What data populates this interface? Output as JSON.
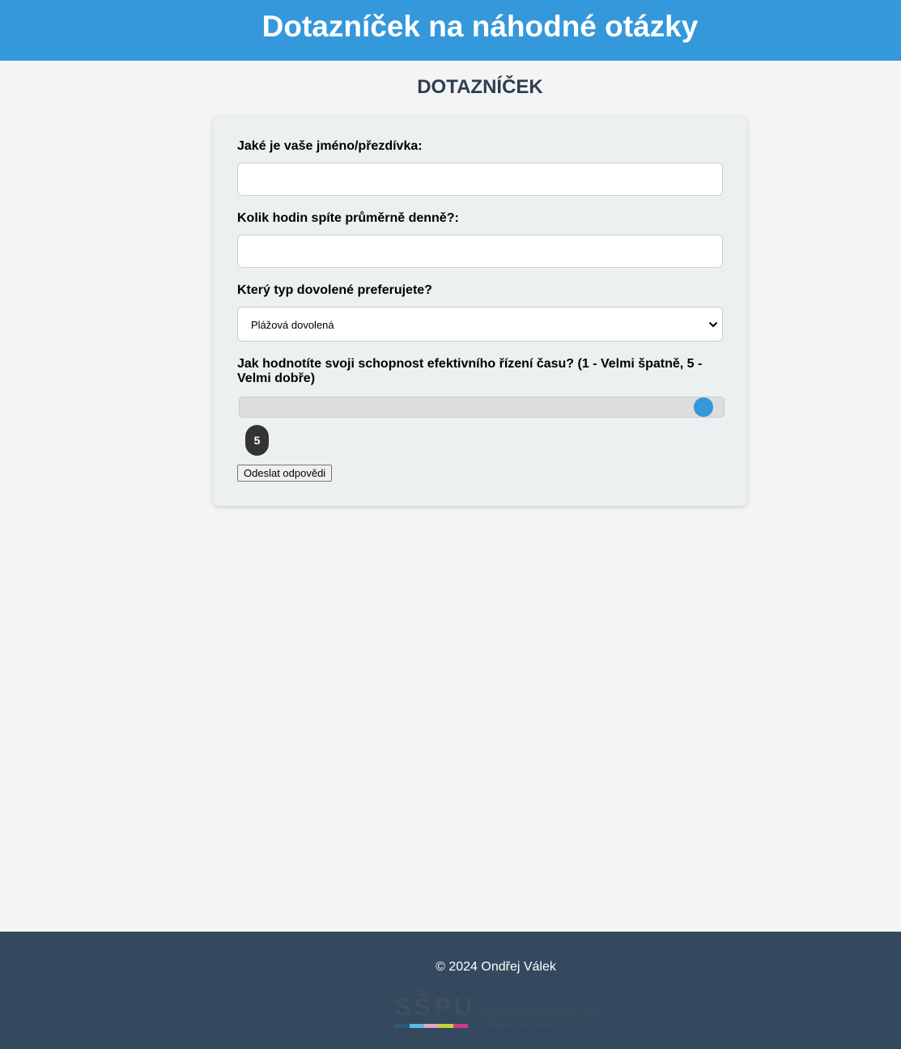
{
  "header": {
    "title": "Dotazníček na náhodné otázky"
  },
  "main": {
    "heading": "DOTAZNÍČEK"
  },
  "form": {
    "q_name": {
      "label": "Jaké je vaše jméno/přezdívka:",
      "value": ""
    },
    "q_sleep": {
      "label": "Kolik hodin spíte průměrně denně?:",
      "value": ""
    },
    "q_vacation": {
      "label": "Který typ dovolené preferujete?",
      "selected": "Plážová dovolená"
    },
    "q_time": {
      "label": "Jak hodnotíte svoji schopnost efektivního řízení času? (1 - Velmi špatně, 5 - Velmi dobře)",
      "min": 1,
      "max": 5,
      "value": 5,
      "badge": "5"
    },
    "submit_label": "Odeslat odpovědi"
  },
  "footer": {
    "copyright": "© 2024 Ondřej Válek",
    "logo": {
      "mark": "SŠPU",
      "line1": "STŘEDNÍ ŠKOLA PRŮMYSLOVÁ",
      "line2": "A UMĚLECKÁ, OPAVA",
      "bar_colors": [
        "#2d5a78",
        "#5bbbe0",
        "#e7a7c2",
        "#c7d23a",
        "#d13a88"
      ]
    }
  },
  "colors": {
    "header_bg": "#3498db",
    "accent": "#3498db",
    "heading": "#2c3e50",
    "footer_bg": "#34495e",
    "card_bg": "#ecf0f1",
    "page_bg": "#f4f4f4"
  },
  "icons": {
    "select_caret": "chevron-down-icon",
    "logo": "sspu-logo"
  }
}
